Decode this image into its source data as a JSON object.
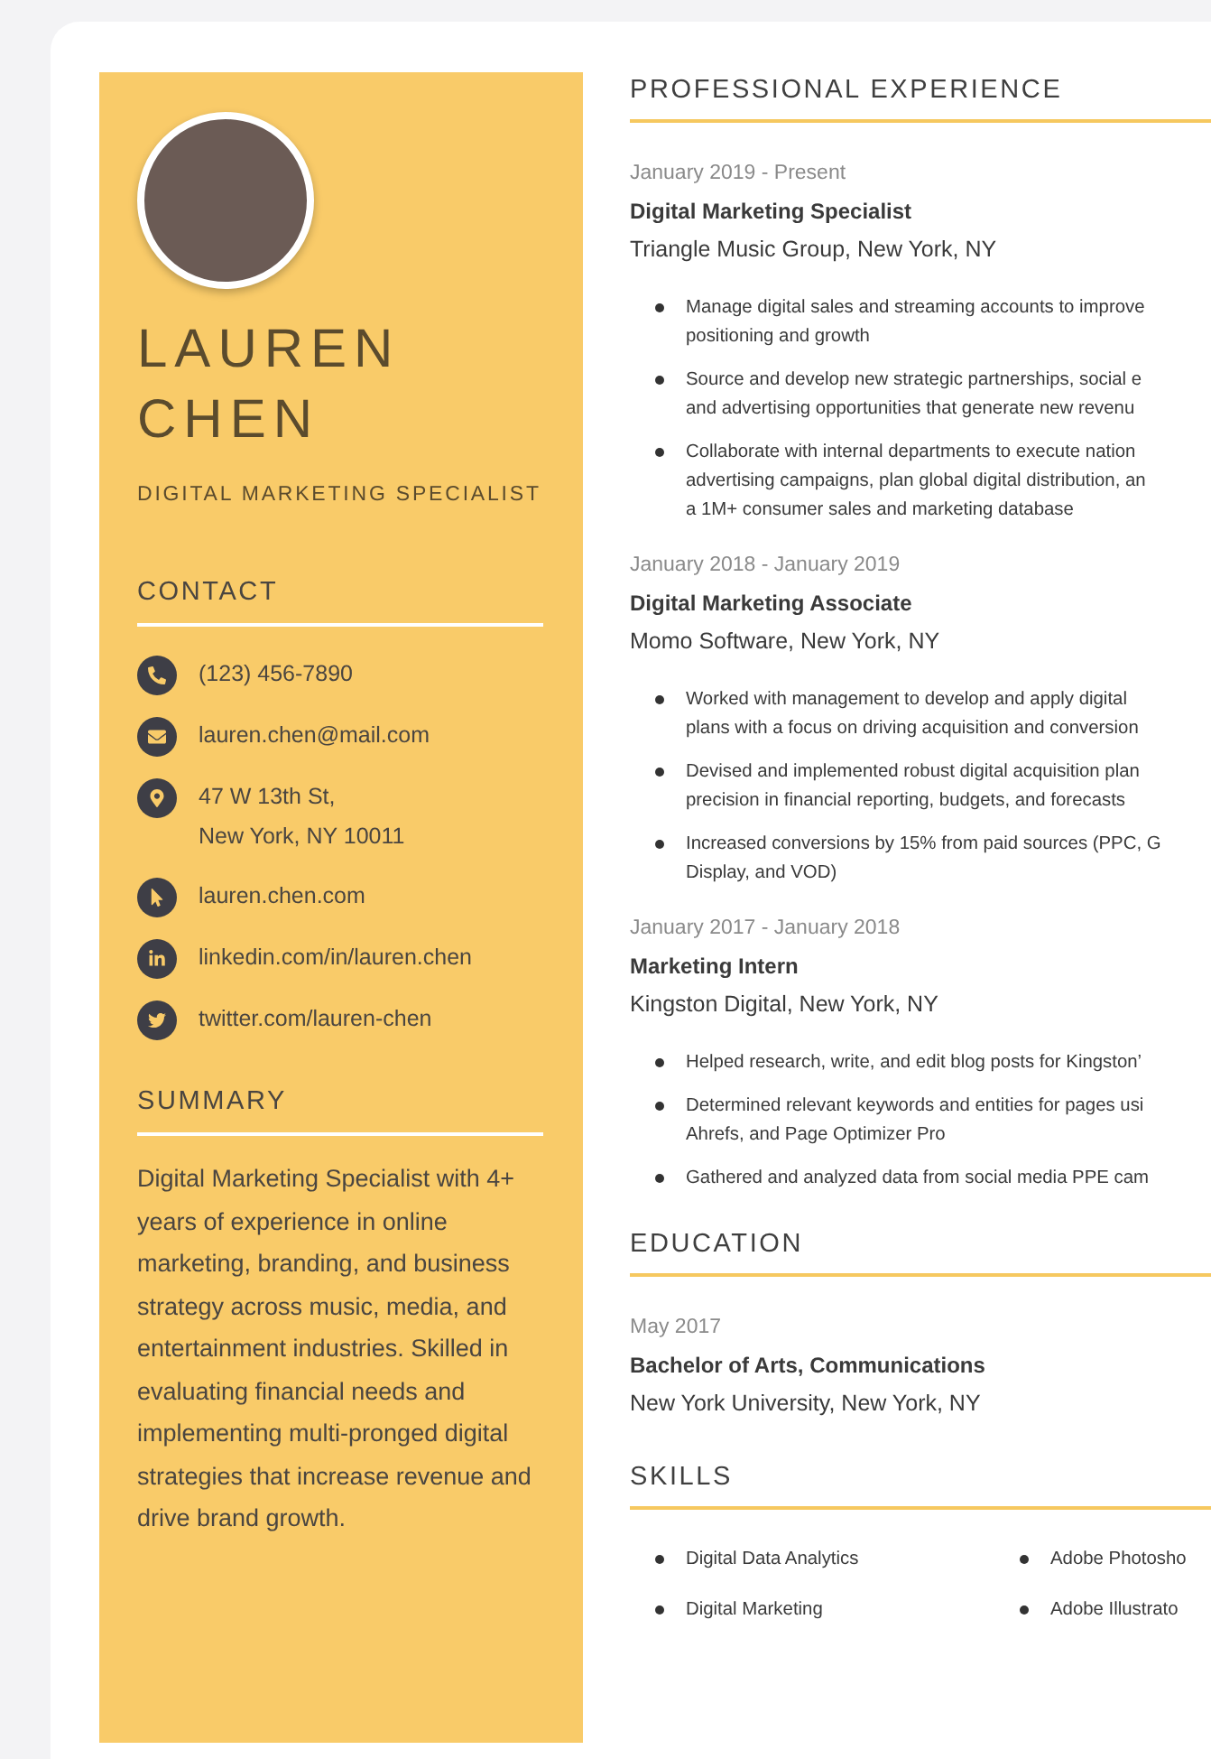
{
  "sidebar": {
    "name": "LAUREN CHEN",
    "title": "DIGITAL MARKETING SPECIALIST",
    "contact": {
      "heading": "CONTACT",
      "items": [
        {
          "kind": "phone",
          "lines": [
            "(123) 456-7890"
          ]
        },
        {
          "kind": "email",
          "lines": [
            "lauren.chen@mail.com"
          ]
        },
        {
          "kind": "address",
          "lines": [
            "47 W 13th St,",
            "New York, NY 10011"
          ]
        },
        {
          "kind": "website",
          "lines": [
            "lauren.chen.com"
          ]
        },
        {
          "kind": "linkedin",
          "lines": [
            "linkedin.com/in/lauren.chen"
          ]
        },
        {
          "kind": "twitter",
          "lines": [
            "twitter.com/lauren-chen"
          ]
        }
      ]
    },
    "summary": {
      "heading": "SUMMARY",
      "text": "Digital Marketing Specialist with 4+ years of experience in online marketing, branding, and business strategy across music, media, and entertainment industries. Skilled in evaluating financial needs and implementing multi-pronged digital strategies that increase revenue and drive brand growth."
    }
  },
  "experience": {
    "heading": "PROFESSIONAL EXPERIENCE",
    "jobs": [
      {
        "dates": "January 2019 - Present",
        "title": "Digital Marketing Specialist",
        "company": "Triangle Music Group,  New York, NY",
        "bullets": [
          [
            "Manage digital sales and streaming accounts to improve",
            "positioning and growth"
          ],
          [
            "Source and develop new strategic partnerships, social e",
            "and advertising opportunities that generate new revenu"
          ],
          [
            "Collaborate with internal departments to execute nation",
            "advertising campaigns, plan global digital distribution, an",
            "a 1M+ consumer sales and marketing database"
          ]
        ]
      },
      {
        "dates": "January 2018 - January 2019",
        "title": "Digital Marketing Associate",
        "company": "Momo Software,  New York, NY",
        "bullets": [
          [
            "Worked with management to develop and apply digital",
            "plans with a focus on driving acquisition and conversion"
          ],
          [
            "Devised and implemented robust digital acquisition plan",
            "precision in financial reporting, budgets, and forecasts"
          ],
          [
            "Increased conversions by 15% from paid sources (PPC, G",
            "Display, and VOD)"
          ]
        ]
      },
      {
        "dates": "January 2017 -  January 2018",
        "title": "Marketing Intern",
        "company": "Kingston Digital,  New York, NY",
        "bullets": [
          [
            "Helped research, write, and edit blog posts for Kingston’"
          ],
          [
            "Determined relevant keywords and entities for pages usi",
            "Ahrefs, and Page Optimizer Pro"
          ],
          [
            "Gathered and analyzed data from social media PPE cam"
          ]
        ]
      }
    ]
  },
  "education": {
    "heading": "EDUCATION",
    "entries": [
      {
        "date": "May 2017",
        "degree": "Bachelor of Arts, Communications",
        "school": "New York University,  New York, NY"
      }
    ]
  },
  "skills": {
    "heading": "SKILLS",
    "items": [
      "Digital Data Analytics",
      "Adobe Photosho",
      "Digital Marketing",
      "Adobe Illustrato"
    ]
  }
}
